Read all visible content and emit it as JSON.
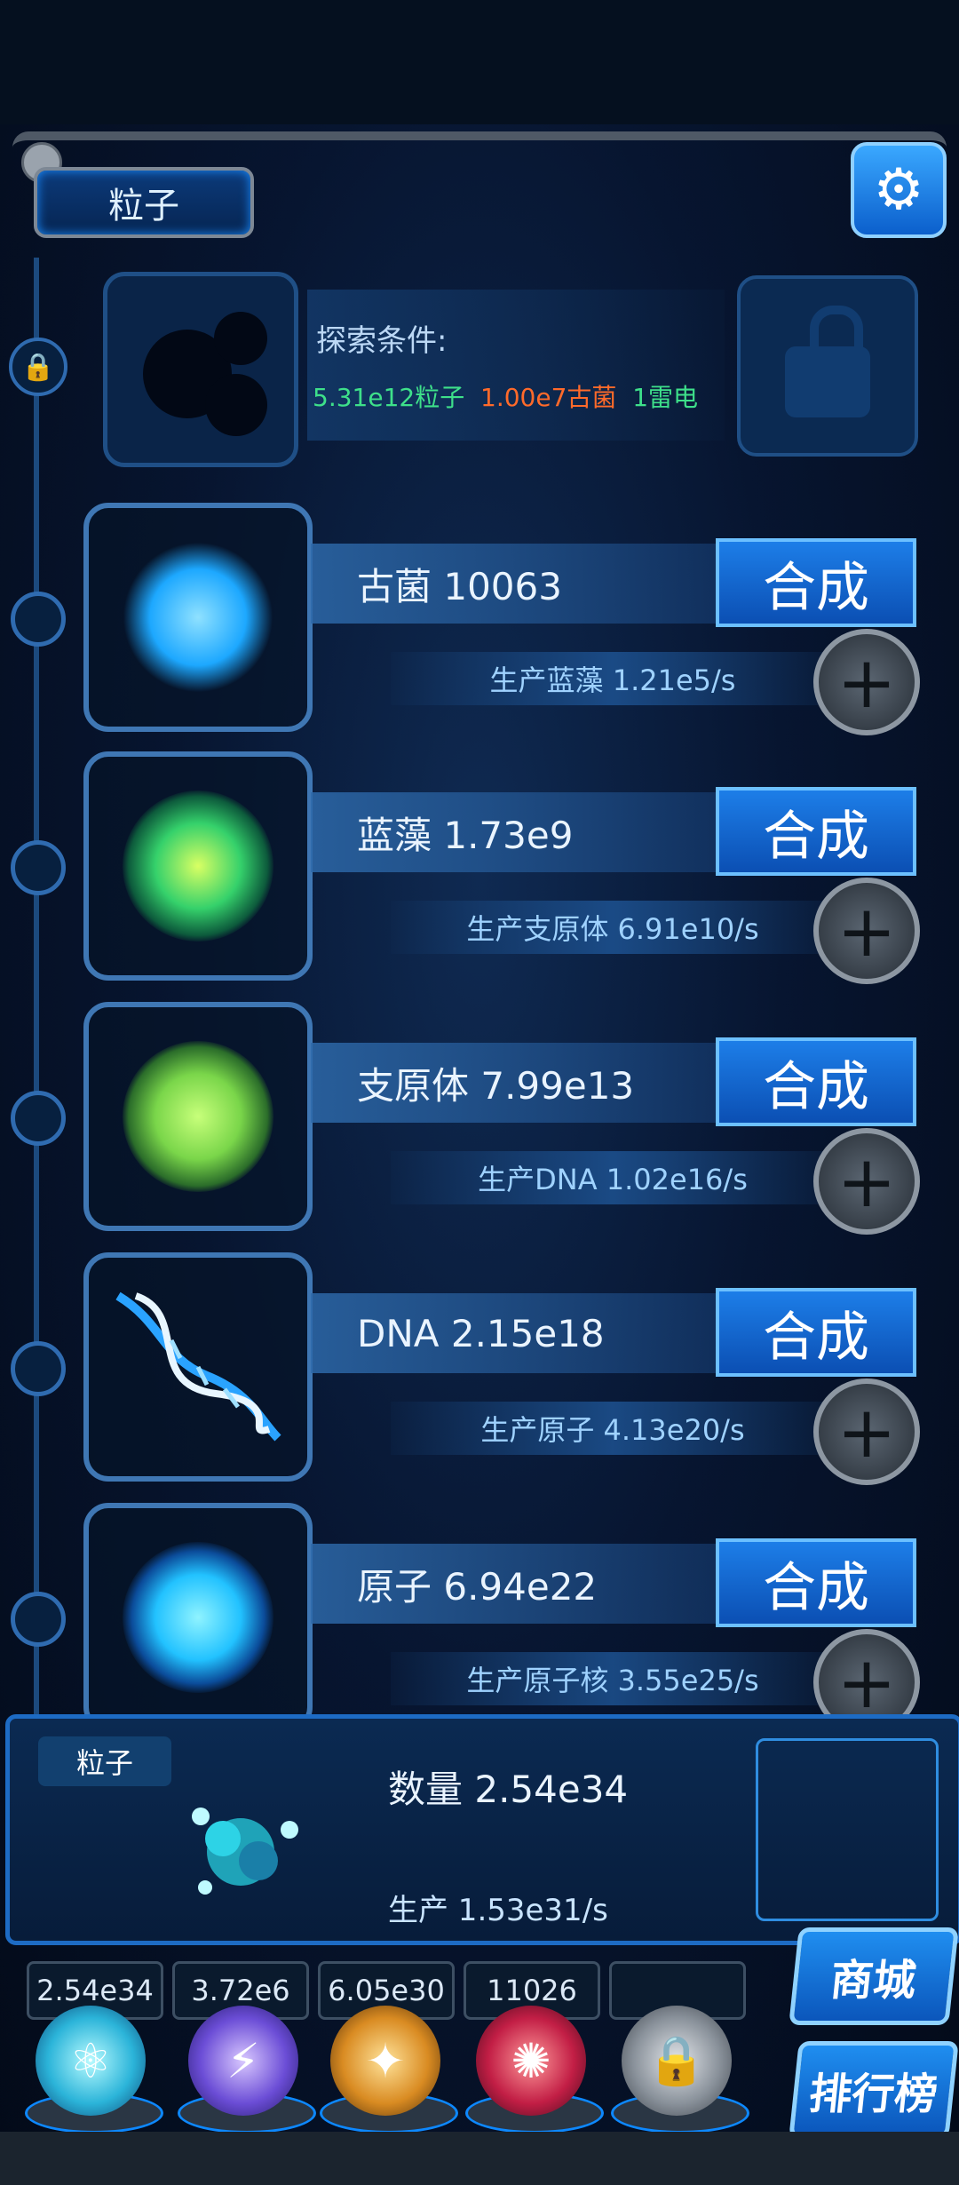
{
  "header": {
    "title": "粒子",
    "settings_icon": "gear-icon"
  },
  "explore": {
    "title": "探索条件:",
    "conditions": [
      {
        "text": "5.31e12粒子",
        "color": "#3ee08a"
      },
      {
        "text": "1.00e7古菌",
        "color": "#ff6a2a"
      },
      {
        "text": "1雷电",
        "color": "#3ee08a"
      }
    ]
  },
  "rows": [
    {
      "name": "古菌 10063",
      "synth_label": "合成",
      "production": "生产蓝藻 1.21e5/s",
      "orb": "#1da8ff"
    },
    {
      "name": "蓝藻 1.73e9",
      "synth_label": "合成",
      "production": "生产支原体 6.91e10/s",
      "orb": "#35d16b"
    },
    {
      "name": "支原体 7.99e13",
      "synth_label": "合成",
      "production": "生产DNA 1.02e16/s",
      "orb": "#7ad64a"
    },
    {
      "name": "DNA 2.15e18",
      "synth_label": "合成",
      "production": "生产原子 4.13e20/s",
      "orb": "#2aa3ff"
    },
    {
      "name": "原子 6.94e22",
      "synth_label": "合成",
      "production": "生产原子核 3.55e25/s",
      "orb": "#22c2ff"
    }
  ],
  "summary": {
    "tag": "粒子",
    "count": "数量 2.54e34",
    "production": "生产 1.53e31/s"
  },
  "resources": [
    "2.54e34",
    "3.72e6",
    "6.05e30",
    "11026",
    ""
  ],
  "side_buttons": {
    "shop": "商城",
    "ranking": "排行榜"
  }
}
